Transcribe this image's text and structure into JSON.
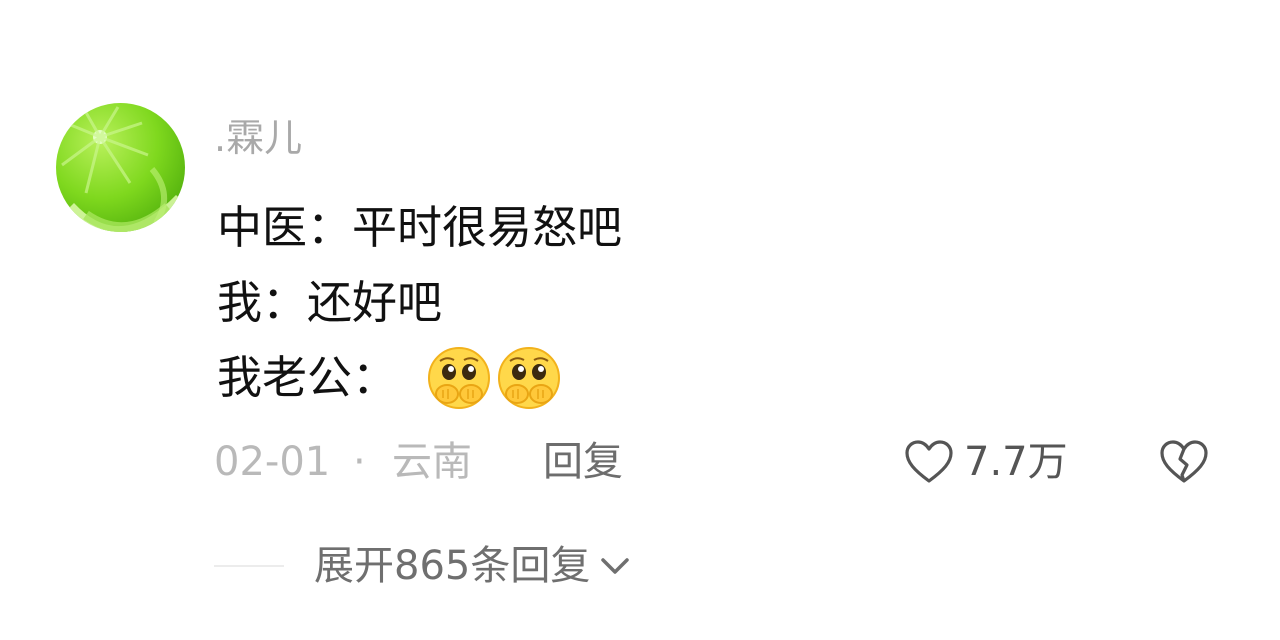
{
  "comment": {
    "avatar_icon": "lime-avatar-icon",
    "username": ".霖儿",
    "lines": [
      "中医：平时很易怒吧",
      "我：还好吧",
      "我老公："
    ],
    "emoji_icon": "pleading-face-emoji-icon",
    "emoji_count": 2,
    "date": "02-01",
    "separator": "·",
    "location": "云南",
    "reply_label": "回复",
    "like_icon": "heart-outline-icon",
    "like_count": "7.7万",
    "dislike_icon": "broken-heart-icon",
    "expand_label": "展开865条回复",
    "expand_icon": "chevron-down-icon"
  },
  "colors": {
    "username": "#a9a9a9",
    "body_text": "#111111",
    "meta_text": "#b9b9b9",
    "action_text": "#6d6d6d",
    "avatar_green": "#7ed321"
  }
}
